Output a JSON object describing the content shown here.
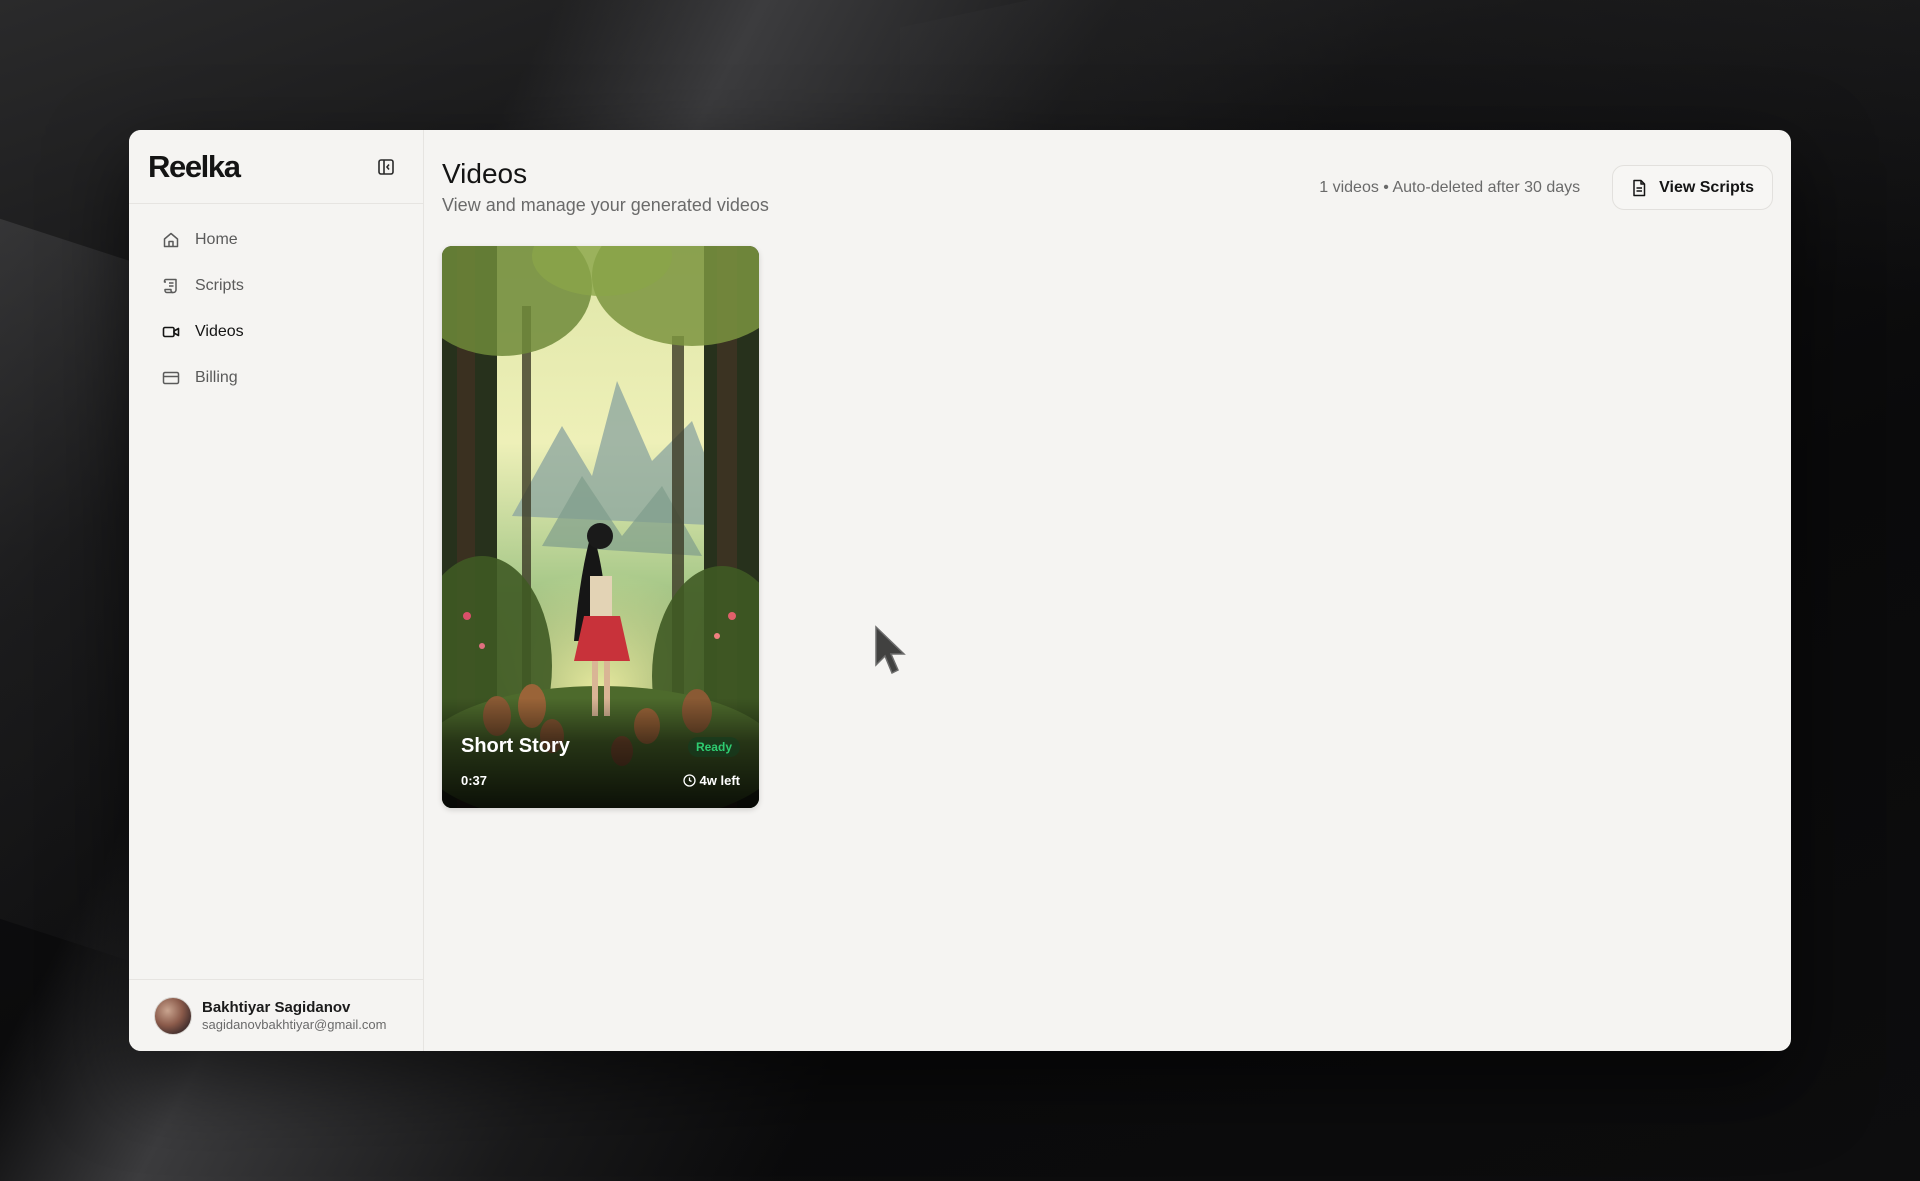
{
  "app": {
    "logo": "Reelka"
  },
  "sidebar": {
    "items": [
      {
        "label": "Home",
        "icon": "home-icon",
        "active": false
      },
      {
        "label": "Scripts",
        "icon": "scroll-icon",
        "active": false
      },
      {
        "label": "Videos",
        "icon": "video-icon",
        "active": true
      },
      {
        "label": "Billing",
        "icon": "credit-card-icon",
        "active": false
      }
    ],
    "user": {
      "name": "Bakhtiyar Sagidanov",
      "email": "sagidanovbakhtiyar@gmail.com"
    }
  },
  "page": {
    "title": "Videos",
    "subtitle": "View and manage your generated videos",
    "meta": "1 videos • Auto-deleted after 30 days",
    "view_scripts_label": "View Scripts"
  },
  "videos": [
    {
      "title": "Short Story",
      "status": "Ready",
      "duration": "0:37",
      "expires": "4w left"
    }
  ],
  "colors": {
    "status_ready": "#2ecc71",
    "window_bg": "#f5f4f2",
    "text_primary": "#141414"
  }
}
